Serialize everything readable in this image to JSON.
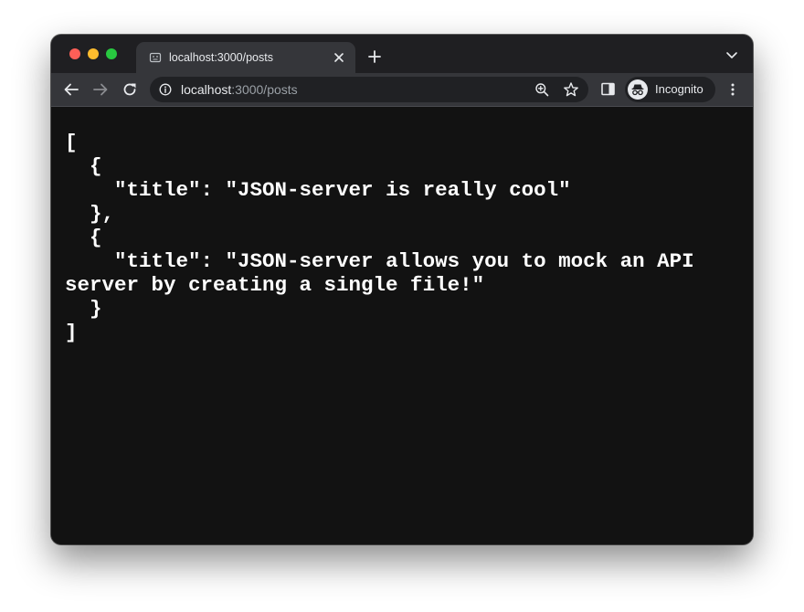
{
  "browser": {
    "tab": {
      "title": "localhost:3000/posts",
      "favicon": "document-icon"
    },
    "toolbar": {
      "url_host": "localhost",
      "url_path": ":3000/posts",
      "profile_label": "Incognito",
      "icons": [
        "back-arrow-icon",
        "forward-arrow-icon",
        "reload-icon",
        "info-icon",
        "zoom-icon",
        "star-icon",
        "side-panel-icon",
        "incognito-icon",
        "kebab-menu-icon"
      ]
    }
  },
  "page": {
    "json_text": "[\n  {\n    \"title\": \"JSON-server is really cool\"\n  },\n  {\n    \"title\": \"JSON-server allows you to mock an API server by creating a single file!\"\n  }\n]"
  },
  "colors": {
    "page_background": "#121212",
    "tab_active": "#35363a",
    "tabstrip": "#1f1f22",
    "omnibox": "#202124",
    "text": "#ffffff"
  }
}
